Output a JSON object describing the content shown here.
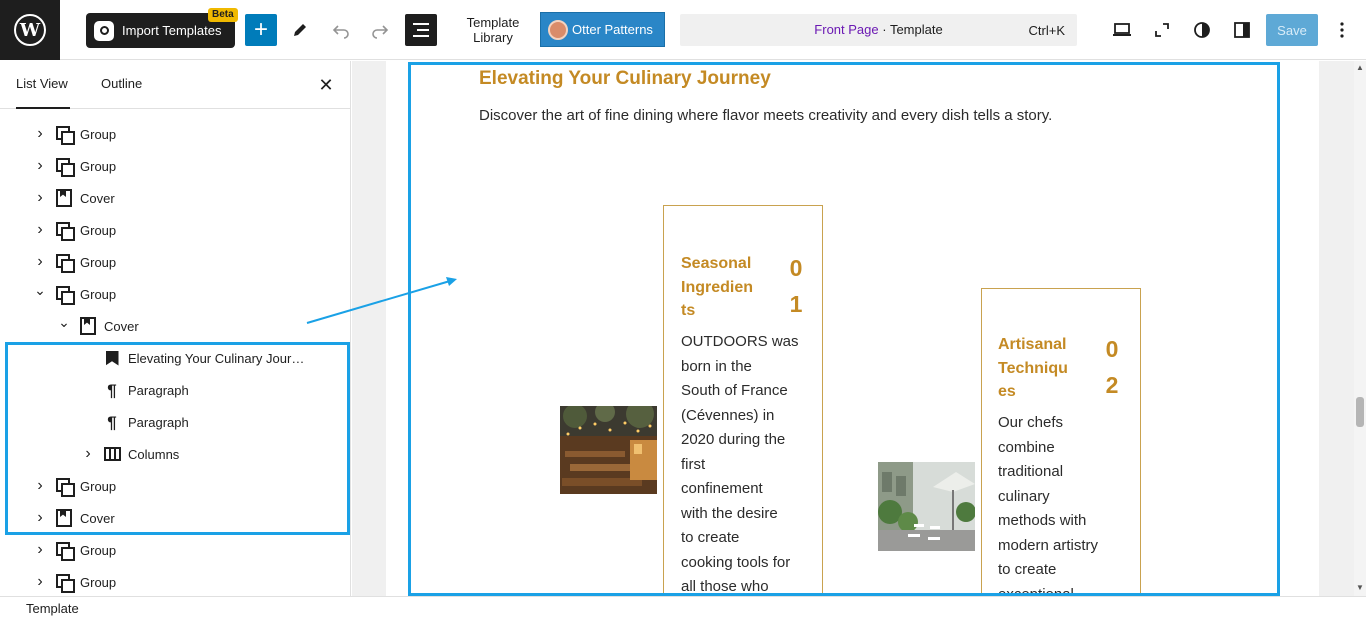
{
  "toolbar": {
    "import_label": "Import Templates",
    "beta_label": "Beta",
    "plus_glyph": "+",
    "template_library_line1": "Template",
    "template_library_line2": "Library",
    "otter_label": "Otter Patterns",
    "command_link": "Front Page",
    "command_rest": " · Template",
    "command_shortcut": "Ctrl+K",
    "save_label": "Save",
    "icons": [
      "wordpress-logo",
      "pen-icon",
      "undo-icon",
      "redo-icon",
      "list-view-icon",
      "desktop-icon",
      "expand-icon",
      "contrast-icon",
      "sidebar-icon",
      "more-icon"
    ]
  },
  "sidebar": {
    "tabs": [
      "List View",
      "Outline"
    ],
    "close_glyph": "✕",
    "tree": [
      {
        "label": "Group",
        "type": "group",
        "depth": 0
      },
      {
        "label": "Group",
        "type": "group",
        "depth": 0
      },
      {
        "label": "Cover",
        "type": "cover",
        "depth": 0
      },
      {
        "label": "Group",
        "type": "group",
        "depth": 0
      },
      {
        "label": "Group",
        "type": "group",
        "depth": 0
      },
      {
        "label": "Group",
        "type": "group",
        "depth": 0,
        "expanded": true
      },
      {
        "label": "Cover",
        "type": "cover",
        "depth": 1,
        "expanded": true
      },
      {
        "label": "Elevating Your Culinary Jour…",
        "type": "heading",
        "depth": 2
      },
      {
        "label": "Paragraph",
        "type": "paragraph",
        "depth": 2
      },
      {
        "label": "Paragraph",
        "type": "paragraph",
        "depth": 2
      },
      {
        "label": "Columns",
        "type": "columns",
        "depth": 2
      },
      {
        "label": "Group",
        "type": "group",
        "depth": 0
      },
      {
        "label": "Cover",
        "type": "cover",
        "depth": 0
      },
      {
        "label": "Group",
        "type": "group",
        "depth": 0
      },
      {
        "label": "Group",
        "type": "group",
        "depth": 0
      }
    ]
  },
  "content": {
    "heading": "Elevating Your Culinary Journey",
    "intro": "Discover the art of fine dining where flavor meets creativity and every dish tells a story.",
    "cards": [
      {
        "title_lines": [
          "Seasonal",
          "Ingredien",
          "ts"
        ],
        "number_lines": [
          "0",
          "1"
        ],
        "body_lines": [
          "OUTDOORS was",
          "born in the",
          "South of France",
          "(Cévennes) in",
          "2020 during the",
          "first",
          "confinement",
          "with the desire",
          "to create",
          "cooking tools for",
          "all those who"
        ]
      },
      {
        "title_lines": [
          "Artisanal",
          "Techniqu",
          "es"
        ],
        "number_lines": [
          "0",
          "2"
        ],
        "body_lines": [
          "Our chefs",
          "combine",
          "traditional",
          "culinary",
          "methods with",
          "modern artistry",
          "to create",
          "exceptional"
        ]
      }
    ]
  },
  "footer": {
    "breadcrumb": "Template"
  },
  "colors": {
    "accent": "#c48a24",
    "selection": "#1aa1e6",
    "wp_blue": "#007cba",
    "otter_blue": "#2a86c7",
    "command_link": "#6b19b3"
  }
}
